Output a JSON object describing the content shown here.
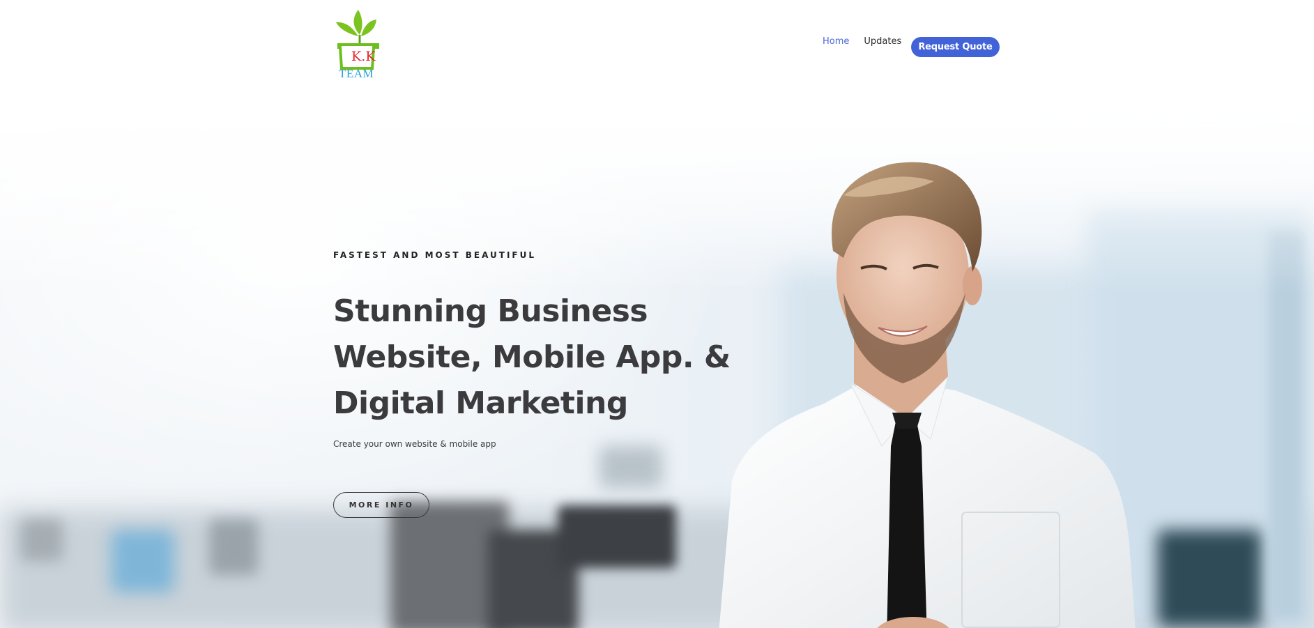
{
  "brand": {
    "logo_initials": "K.K",
    "logo_team": "TEAM",
    "logo_colors": {
      "leaves": "#7bc31f",
      "pot": "#6cbf1e",
      "initials": "#e8252e",
      "team": "#2aa0d6"
    }
  },
  "nav": {
    "items": [
      {
        "label": "Home",
        "active": true
      },
      {
        "label": "Updates",
        "active": false
      }
    ],
    "cta_label": "Request Quote",
    "accent_color": "#4263d8"
  },
  "hero": {
    "eyebrow": "FASTEST AND MOST BEAUTIFUL",
    "headline_lines": [
      "Stunning Business",
      "Website, Mobile App. &",
      "Digital Marketing"
    ],
    "subtext": "Create your own website & mobile app",
    "button_label": "MORE INFO",
    "text_color": "#3b3b3d"
  }
}
